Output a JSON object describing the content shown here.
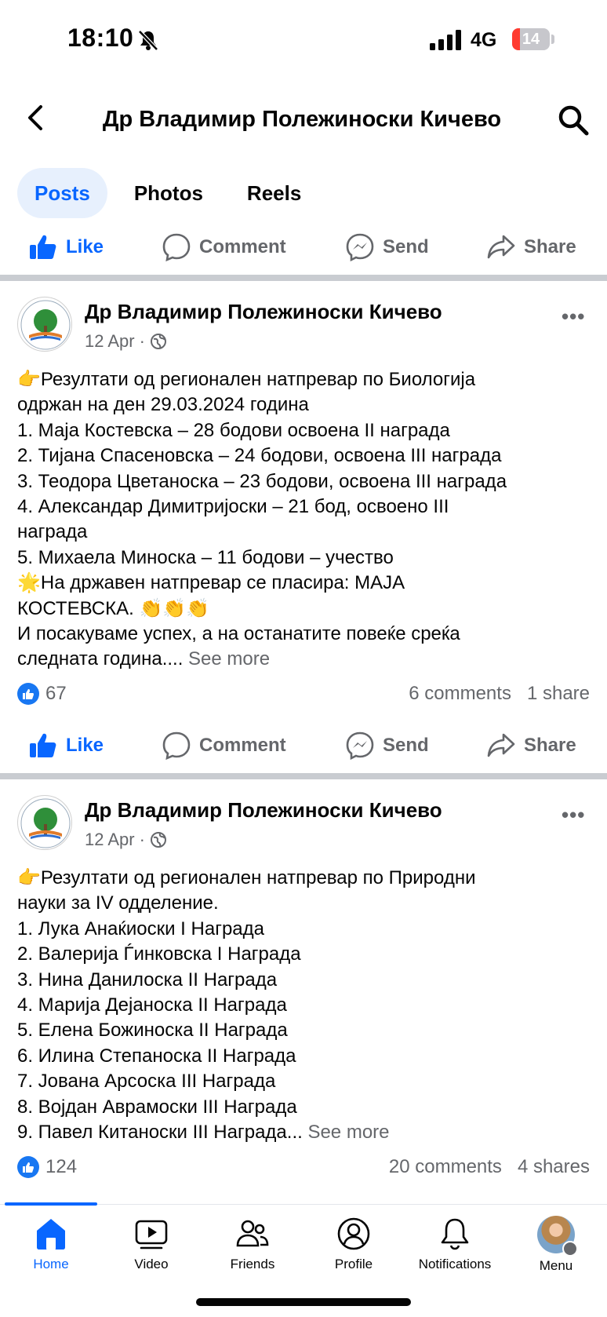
{
  "status_bar": {
    "time": "18:10",
    "network": "4G",
    "battery": "14"
  },
  "header": {
    "title": "Др Владимир Полежиноски Кичево"
  },
  "tabs": [
    {
      "label": "Posts",
      "active": true
    },
    {
      "label": "Photos",
      "active": false
    },
    {
      "label": "Reels",
      "active": false
    }
  ],
  "actions": {
    "like": "Like",
    "comment": "Comment",
    "send": "Send",
    "share": "Share"
  },
  "posts": [
    {
      "author": "Др Владимир Полежиноски Кичево",
      "date": "12 Apr",
      "lines": [
        "👉Резултати од регионален натпревар по Биологија",
        "одржан на ден 29.03.2024 година",
        "1. Маја Костевска – 28 бодови освоена II награда",
        "2. Тијана Спасеновска – 24 бодови, освоена III награда",
        "3. Теодора Цветаноска – 23 бодови, освоена III награда",
        "4. Александар Димитријоски – 21 бод, освоено III",
        "награда",
        "5. Михаела Миноска – 11 бодови – учество",
        "🌟На државен натпревар се пласира: МАЈА",
        "КОСТЕВСКА. 👏👏👏",
        "И посакуваме успех, а на останатите повеќе среќа"
      ],
      "last_line": "следната година....",
      "see_more": "See more",
      "likes": "67",
      "comments_shares": "6 comments   1 share"
    },
    {
      "author": "Др Владимир Полежиноски Кичево",
      "date": "12 Apr",
      "lines": [
        "👉Резултати од регионален натпревар по Природни",
        "науки за IV одделение.",
        "1. Лука Анаќиоски I Награда",
        "2. Валерија Ѓинковска I Награда",
        "3. Нина Данилоска II Награда",
        "4. Марија Дејаноска II Награда",
        "5. Елена Божиноска II Награда",
        "6. Илина Степаноска II Награда",
        "7. Јована Арсоска III Награда",
        "8. Војдан Аврамоски III Награда"
      ],
      "last_line": "9. Павел Китаноски III Награда...",
      "see_more": "See more",
      "likes": "124",
      "comments_shares": "20 comments   4 shares"
    }
  ],
  "bottom_nav": [
    {
      "label": "Home",
      "icon": "home-icon",
      "active": true
    },
    {
      "label": "Video",
      "icon": "video-icon",
      "active": false
    },
    {
      "label": "Friends",
      "icon": "friends-icon",
      "active": false
    },
    {
      "label": "Profile",
      "icon": "profile-icon",
      "active": false
    },
    {
      "label": "Notifications",
      "icon": "bell-icon",
      "active": false
    },
    {
      "label": "Menu",
      "icon": "menu-avatar",
      "active": false
    }
  ],
  "colors": {
    "accent": "#0866ff",
    "secondary_text": "#65676b",
    "divider": "#c9ccd1"
  }
}
